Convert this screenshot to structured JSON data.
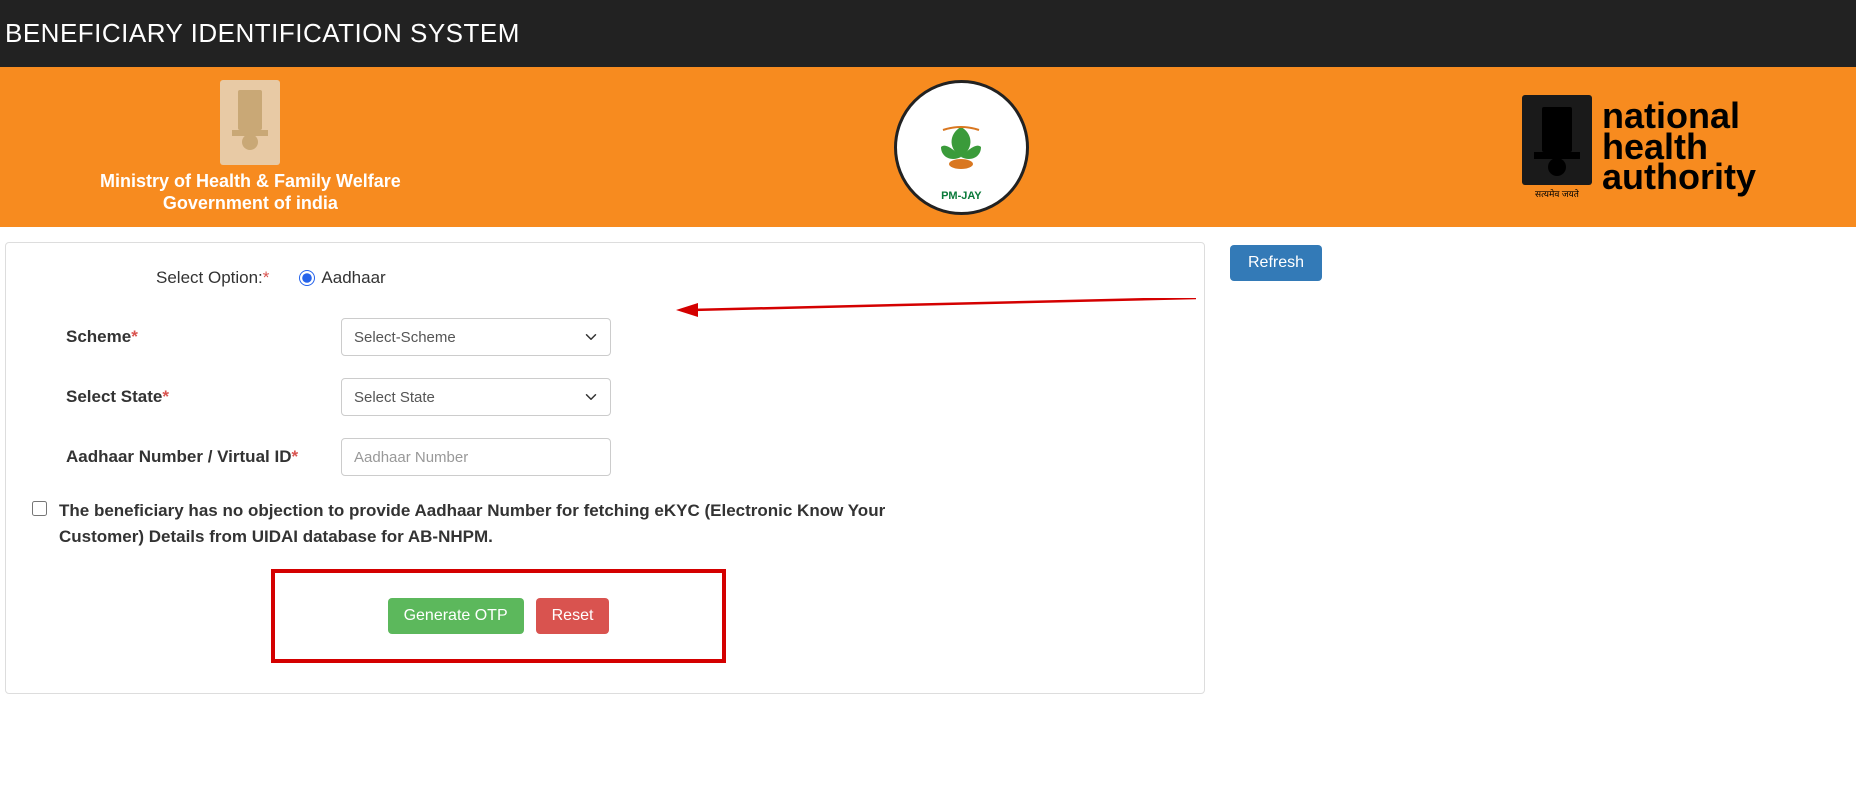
{
  "topbar": {
    "title": "BENEFICIARY IDENTIFICATION SYSTEM"
  },
  "header": {
    "ministry_line1": "Ministry of Health & Family Welfare",
    "ministry_line2": "Government of india",
    "center_scheme": "PM-JAY",
    "nha_line1": "national",
    "nha_line2": "health",
    "nha_line3": "authority",
    "satyamev": "सत्यमेव जयते"
  },
  "form": {
    "select_option_label": "Select Option:",
    "aadhaar_radio_label": "Aadhaar",
    "scheme_label": "Scheme",
    "scheme_placeholder": "Select-Scheme",
    "state_label": "Select State",
    "state_placeholder": "Select State",
    "aadhaar_label": "Aadhaar Number / Virtual ID",
    "aadhaar_placeholder": "Aadhaar Number",
    "consent_text": "The beneficiary has no objection to provide Aadhaar Number for fetching eKYC (Electronic Know Your Customer) Details from UIDAI database for AB-NHPM.",
    "generate_otp_btn": "Generate OTP",
    "reset_btn": "Reset"
  },
  "side": {
    "refresh_btn": "Refresh"
  }
}
